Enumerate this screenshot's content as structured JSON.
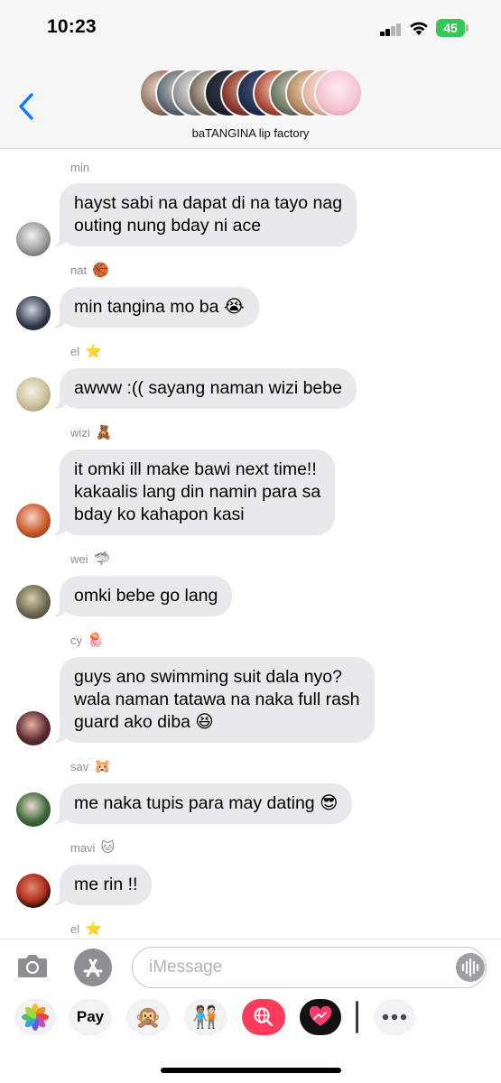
{
  "status_bar": {
    "time": "10:23",
    "battery": "45"
  },
  "chat": {
    "title": "baTANGINA lip factory"
  },
  "messages": [
    {
      "sender": "min",
      "sender_emoji": "",
      "text": "hayst sabi na dapat di na tayo nag\nouting nung bday ni ace"
    },
    {
      "sender": "nat",
      "sender_emoji": "🏀",
      "text": "min tangina mo ba 😭"
    },
    {
      "sender": "el",
      "sender_emoji": "⭐",
      "text": "awww :(( sayang naman wizi bebe"
    },
    {
      "sender": "wizi",
      "sender_emoji": "🧸",
      "text": "it omki ill make bawi next time!!\nkakaalis lang din namin para sa\nbday ko kahapon kasi"
    },
    {
      "sender": "wei",
      "sender_emoji": "🦈",
      "text": "omki bebe go lang"
    },
    {
      "sender": "cy",
      "sender_emoji": "🪼",
      "text": "guys ano swimming suit dala nyo?\nwala naman tatawa na naka full rash\nguard ako diba 😆"
    },
    {
      "sender": "sav",
      "sender_emoji": "🐹",
      "text": "me naka tupis para may dating 😎"
    },
    {
      "sender": "mavi",
      "sender_emoji": "🐱",
      "text": "me rin !!"
    },
    {
      "sender": "el",
      "sender_emoji": "⭐",
      "text": ""
    }
  ],
  "composer": {
    "placeholder": "iMessage"
  },
  "app_drawer": {
    "apple_pay_label": "Pay",
    "items": [
      "photos-app",
      "apple-pay-app",
      "memoji-monkey-app",
      "memoji-stickers-app",
      "search-images-app",
      "digital-touch-app",
      "more-apps"
    ]
  },
  "colors": {
    "bubble_gray": "#e9e9eb",
    "back_blue": "#0a7aff",
    "battery_green": "#35c759"
  }
}
